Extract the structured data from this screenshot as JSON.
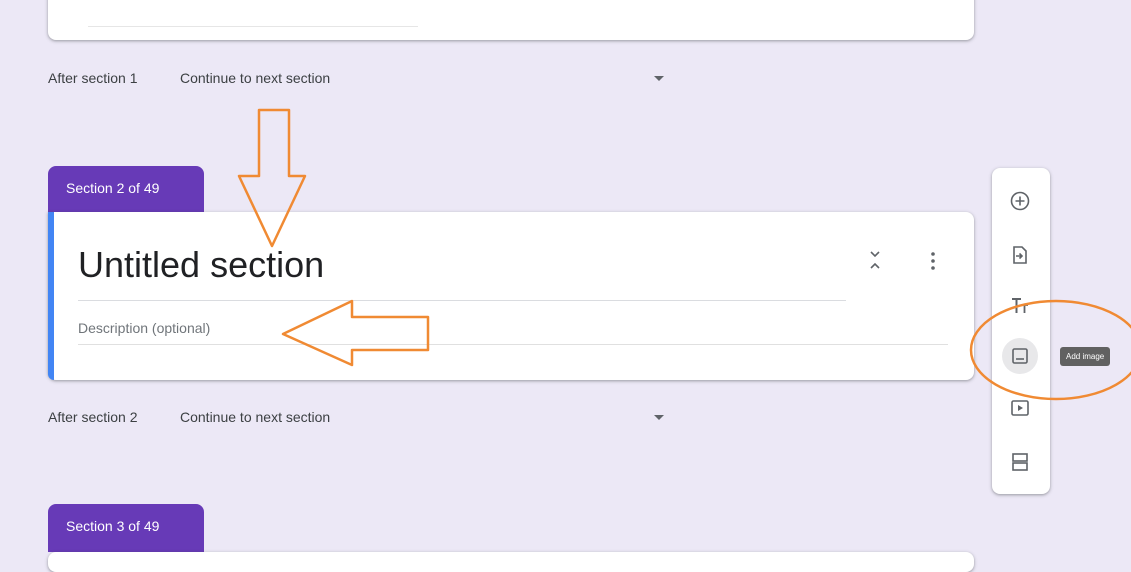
{
  "after_section_1": {
    "label": "After section 1",
    "value": "Continue to next section"
  },
  "section_2": {
    "badge": "Section 2 of 49",
    "title": "Untitled section",
    "description_placeholder": "Description (optional)"
  },
  "after_section_2": {
    "label": "After section 2",
    "value": "Continue to next section"
  },
  "section_3": {
    "badge": "Section 3 of 49"
  },
  "toolbar": {
    "items": [
      {
        "icon": "add-question-icon"
      },
      {
        "icon": "import-questions-icon"
      },
      {
        "icon": "add-title-icon"
      },
      {
        "icon": "add-image-icon"
      },
      {
        "icon": "add-video-icon"
      },
      {
        "icon": "add-section-icon"
      }
    ],
    "tooltip": "Add image"
  },
  "colors": {
    "background": "#ece8f6",
    "section_badge": "#673ab7",
    "accent_bar": "#4285f4",
    "annotation": "#f08a33"
  }
}
